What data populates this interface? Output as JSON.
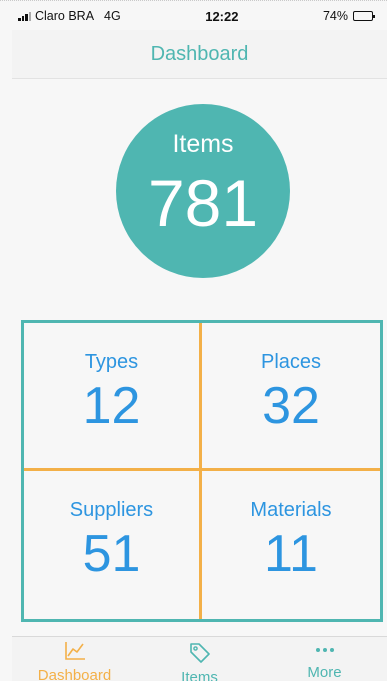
{
  "status_bar": {
    "carrier": "Claro BRA",
    "network": "4G",
    "time": "12:22",
    "battery": "74%"
  },
  "nav": {
    "title": "Dashboard"
  },
  "hero": {
    "label": "Items",
    "value": "781"
  },
  "stats": [
    {
      "label": "Types",
      "value": "12"
    },
    {
      "label": "Places",
      "value": "32"
    },
    {
      "label": "Suppliers",
      "value": "51"
    },
    {
      "label": "Materials",
      "value": "11"
    }
  ],
  "tabs": [
    {
      "label": "Dashboard",
      "icon": "chart-line-icon",
      "active": true
    },
    {
      "label": "Items",
      "icon": "tag-icon",
      "active": false
    },
    {
      "label": "More",
      "icon": "more-dots-icon",
      "active": false
    }
  ],
  "colors": {
    "teal": "#4fb6b1",
    "orange": "#f3b048",
    "blue": "#2d95e0"
  }
}
